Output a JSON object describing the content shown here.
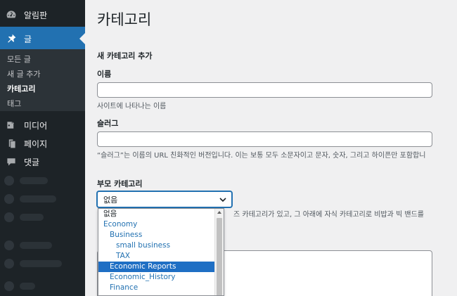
{
  "sidebar": {
    "dashboard": "알림판",
    "posts": "글",
    "sub": [
      "모든 글",
      "새 글 추가",
      "카테고리",
      "태그"
    ],
    "media": "미디어",
    "pages": "페이지",
    "comments": "댓글"
  },
  "main": {
    "title": "카테고리",
    "section_title": "새 카테고리 추가",
    "name_label": "이름",
    "name_desc": "사이트에 나타나는 이름",
    "slug_label": "슬러그",
    "slug_desc": "“슬러그”는 이름의 URL 친화적인 버전입니다. 이는 보통 모두 소문자이고 문자, 숫자, 그리고 하이픈만 포함합니",
    "parent_label": "부모 카테고리",
    "parent_selected": "없음",
    "parent_desc_partial": "즈 카테고리가 있고, 그 아래에 자식 카테고리로 비밥과 빅 밴드를",
    "options": [
      "없음",
      "Economy",
      "Business",
      "small business",
      "TAX",
      "Economic Reports",
      "Economic_History",
      "Finance"
    ]
  }
}
